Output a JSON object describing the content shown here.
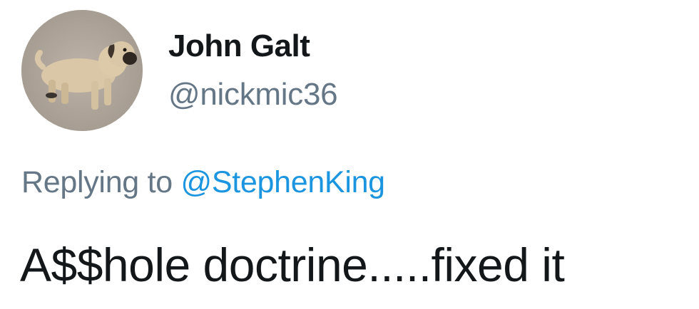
{
  "author": {
    "display_name": "John Galt",
    "handle": "@nickmic36",
    "avatar_icon": "dog-photo-avatar"
  },
  "reply": {
    "prefix": "Replying to",
    "to": "@StephenKing"
  },
  "tweet": {
    "text": "A$$hole doctrine.....fixed it"
  },
  "colors": {
    "name": "#14171a",
    "secondary": "#657786",
    "link": "#1b95e0"
  }
}
